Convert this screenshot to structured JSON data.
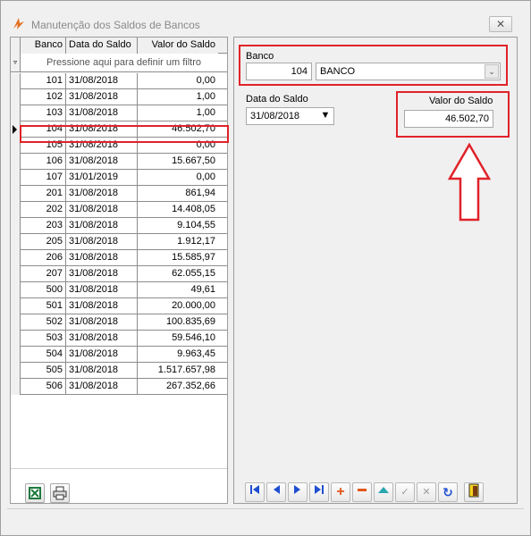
{
  "window": {
    "title": "Manutenção dos Saldos de Bancos",
    "close_glyph": "✕"
  },
  "grid": {
    "columns": [
      "Banco",
      "Data do Saldo",
      "Valor do Saldo"
    ],
    "filter_text": "Pressione aqui para definir um filtro",
    "selected_index": 3,
    "rows": [
      {
        "banco": "101",
        "data": "31/08/2018",
        "valor": "0,00"
      },
      {
        "banco": "102",
        "data": "31/08/2018",
        "valor": "1,00"
      },
      {
        "banco": "103",
        "data": "31/08/2018",
        "valor": "1,00"
      },
      {
        "banco": "104",
        "data": "31/08/2018",
        "valor": "46.502,70"
      },
      {
        "banco": "105",
        "data": "31/08/2018",
        "valor": "0,00"
      },
      {
        "banco": "106",
        "data": "31/08/2018",
        "valor": "15.667,50"
      },
      {
        "banco": "107",
        "data": "31/01/2019",
        "valor": "0,00"
      },
      {
        "banco": "201",
        "data": "31/08/2018",
        "valor": "861,94"
      },
      {
        "banco": "202",
        "data": "31/08/2018",
        "valor": "14.408,05"
      },
      {
        "banco": "203",
        "data": "31/08/2018",
        "valor": "9.104,55"
      },
      {
        "banco": "205",
        "data": "31/08/2018",
        "valor": "1.912,17"
      },
      {
        "banco": "206",
        "data": "31/08/2018",
        "valor": "15.585,97"
      },
      {
        "banco": "207",
        "data": "31/08/2018",
        "valor": "62.055,15"
      },
      {
        "banco": "500",
        "data": "31/08/2018",
        "valor": "49,61"
      },
      {
        "banco": "501",
        "data": "31/08/2018",
        "valor": "20.000,00"
      },
      {
        "banco": "502",
        "data": "31/08/2018",
        "valor": "100.835,69"
      },
      {
        "banco": "503",
        "data": "31/08/2018",
        "valor": "59.546,10"
      },
      {
        "banco": "504",
        "data": "31/08/2018",
        "valor": "9.963,45"
      },
      {
        "banco": "505",
        "data": "31/08/2018",
        "valor": "1.517.657,98"
      },
      {
        "banco": "506",
        "data": "31/08/2018",
        "valor": "267.352,66"
      }
    ]
  },
  "form": {
    "banco_label": "Banco",
    "banco_code": "104",
    "banco_name": "BANCO",
    "data_label": "Data do Saldo",
    "data_value": "31/08/2018",
    "valor_label": "Valor do Saldo",
    "valor_value": "46.502,70"
  },
  "toolbar": {
    "icons": [
      "excel-export-icon",
      "print-icon"
    ]
  },
  "navigator": {
    "buttons": [
      "first",
      "prior",
      "next",
      "last",
      "insert",
      "delete",
      "edit",
      "post",
      "cancel",
      "refresh"
    ],
    "exit_icon": "exit-door-icon"
  },
  "colors": {
    "highlight_red": "#e1222a",
    "window_bg": "#f0f0f0",
    "grid_line": "#8c8c8c"
  }
}
